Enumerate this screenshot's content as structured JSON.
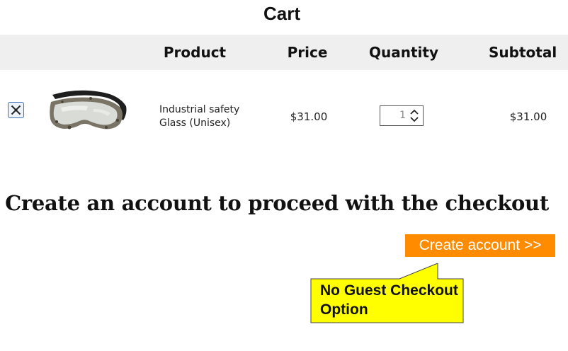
{
  "page": {
    "title": "Cart"
  },
  "table": {
    "headers": {
      "product": "Product",
      "price": "Price",
      "quantity": "Quantity",
      "subtotal": "Subtotal"
    },
    "rows": [
      {
        "product_name": "Industrial safety Glass (Unisex)",
        "price": "$31.00",
        "quantity": "1",
        "subtotal": "$31.00",
        "image_icon": "safety-goggles"
      }
    ]
  },
  "checkout": {
    "headline": "Create an account to proceed with the checkout",
    "create_account_label": "Create account >>",
    "button_color": "#ff8c00"
  },
  "callout": {
    "text": "No Guest Checkout Option",
    "background": "#ffff00"
  },
  "colors": {
    "header_bg": "#efefef",
    "remove_border": "#3c6fb7"
  }
}
